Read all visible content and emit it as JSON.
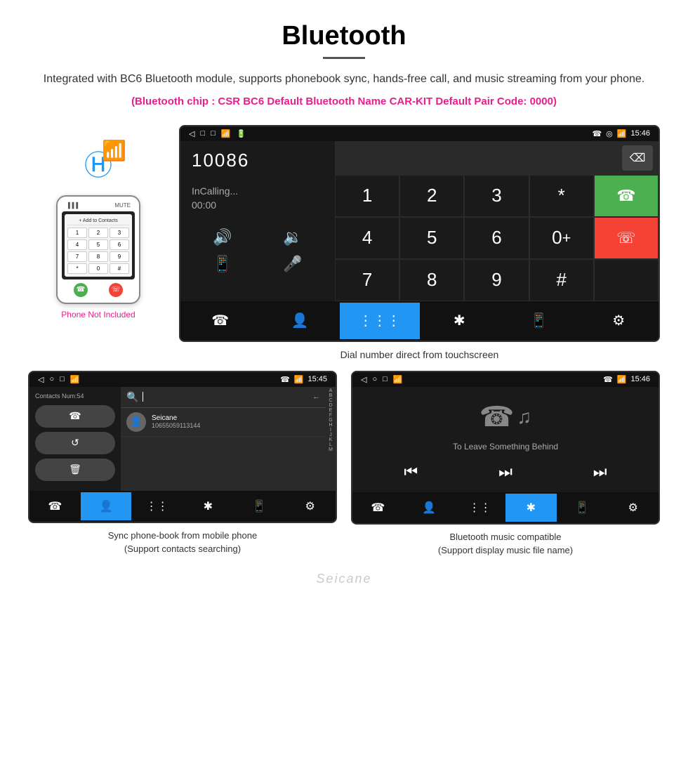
{
  "header": {
    "title": "Bluetooth",
    "description": "Integrated with BC6 Bluetooth module, supports phonebook sync, hands-free call, and music streaming from your phone.",
    "specs": "(Bluetooth chip : CSR BC6    Default Bluetooth Name CAR-KIT    Default Pair Code: 0000)"
  },
  "phone_section": {
    "not_included": "Phone Not Included"
  },
  "main_screen": {
    "status_bar": {
      "left_icons": [
        "back-icon",
        "circle-icon",
        "square-icon",
        "sim-icon",
        "battery-icon"
      ],
      "right_icons": [
        "phone-icon",
        "location-icon",
        "wifi-icon"
      ],
      "time": "15:46"
    },
    "dialer": {
      "number": "10086",
      "calling_label": "InCalling...",
      "timer": "00:00",
      "keys": [
        "1",
        "2",
        "3",
        "*",
        "4",
        "5",
        "6",
        "0+",
        "7",
        "8",
        "9",
        "#"
      ]
    },
    "caption": "Dial number direct from touchscreen"
  },
  "contacts_screen": {
    "status": {
      "time": "15:45"
    },
    "contacts_count": "Contacts Num:54",
    "contact": {
      "name": "Seicane",
      "number": "10655059113144"
    },
    "alpha_letters": [
      "A",
      "B",
      "C",
      "D",
      "E",
      "F",
      "G",
      "H",
      "I",
      "J",
      "K",
      "L",
      "M"
    ],
    "caption_line1": "Sync phone-book from mobile phone",
    "caption_line2": "(Support contacts searching)"
  },
  "music_screen": {
    "status": {
      "time": "15:46"
    },
    "song_title": "To Leave Something Behind",
    "caption_line1": "Bluetooth music compatible",
    "caption_line2": "(Support display music file name)"
  },
  "watermark": "Seicane"
}
